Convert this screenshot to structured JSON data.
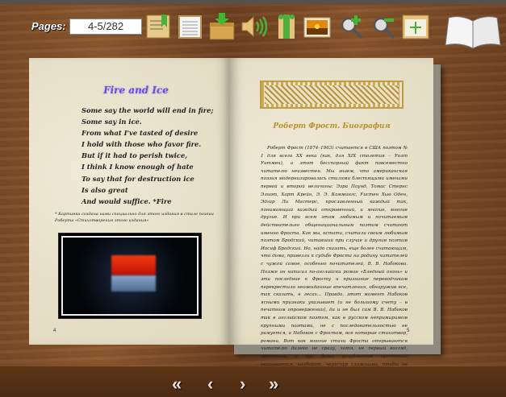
{
  "toolbar": {
    "pages_label": "Pages:",
    "pages_value": "4-5/282",
    "buttons": [
      "bookmark-icon",
      "table-of-contents-icon",
      "download-icon",
      "sound-icon",
      "print-icon",
      "photo-icon",
      "zoom-in-icon",
      "zoom-out-icon",
      "fullscreen-icon"
    ]
  },
  "left_page": {
    "title": "Fire and Ice",
    "poem": [
      "Some say the world will end in fire;",
      "Some say in ice.",
      "From what I've tasted of desire",
      "I hold with those who favor fire.",
      "But if it had to perish twice,",
      "I think I know enough of hate",
      "To say that for destruction ice",
      "Is also great",
      "And would suffice. *Fire"
    ],
    "footnote": "* Картинка создана нами специально для этого издания в стиле поэзии Роберта «Стихотворения этого издания»",
    "page_number": "4"
  },
  "right_page": {
    "title": "Роберт Фрост. Биография",
    "body": "Роберт Фрост (1874–1963) считается в США поэтом № 1 для всего XX века (как, для XIX столетия – Уолт Уитмен), а этот бесспорный факт повсеместно читателю неизвестен. Мы знаем, что американская поэзия модернизировалась стилями блестящими именами первой и второй величины: Эзра Паунд, Томас Стернс Элиот, Харт Крейн, Э. Э. Каммингс, Уистен Хью Оден, Эдгар Ли Мастерс, прославленный каждый так, понимающий каждый откровенный, и многие, многие другие. И при всем этом любимым и почитаемым действительно общенациональным поэтом считают именно Фроста. Как мы, кстати, считали своим любимым поэтом Бродский, читавший при случае и другим поэтам Иосиф Бродский. Но, надо сказать, еще более считающим, что дома, привезли к судьбе Фроста на родину читателей с чужой самое, особенно почитателей, В. В. Набокова. Позже он написал по-английски роман «Бледный огонь» и эти последние к Фросту и признание переводчикам перекрестило неожиданные впечатления, обнаружив все, так сказать, в лесах… Правда, этот момент Набоков ясными признаки указывает (и не большому счету – в печатном опровержении), да и не был сам В. В. Набоков так в английском поэтом, как в русском непримиримом крупными поэтами, не с последовательностью не римуется, а Набоков с Фростом, все которые стихотвор, романа. Вот как многие стихи Фроста открываются читателю далеко не сразу, хотя, не первый взгляд, простыми, а при более углубленном прочтении оказывается, наоборот, чересчур сложными, чтобы не охватить целиком.",
    "page_number": "5"
  },
  "nav": {
    "first": "«",
    "prev": "‹",
    "next": "›",
    "last": "»"
  }
}
